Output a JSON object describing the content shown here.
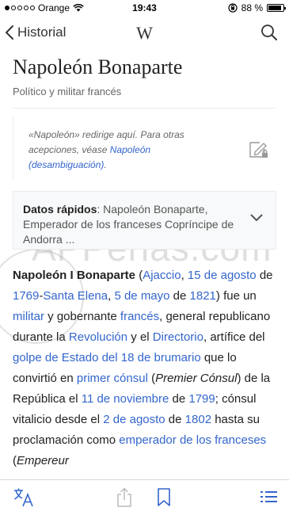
{
  "status": {
    "carrier": "Orange",
    "time": "19:43",
    "battery": "88 %",
    "battery_level": 0.88
  },
  "nav": {
    "back_label": "Historial",
    "logo": "W"
  },
  "article": {
    "title": "Napoleón Bonaparte",
    "subtitle": "Político y militar francés",
    "hatnote": {
      "pre": "«Napoleón» redirige aquí. Para otras acepciones, véase ",
      "link": "Napoleón (desambiguación)",
      "post": "."
    },
    "quick_facts": {
      "label": "Datos rápidos",
      "text": ": Napoleón Bonaparte, Emperador de los franceses Copríncipe de Andorra ..."
    },
    "paragraph": [
      {
        "t": "Napoleón I Bonaparte",
        "b": true
      },
      {
        "t": " ("
      },
      {
        "t": "Ajaccio",
        "l": true
      },
      {
        "t": ", "
      },
      {
        "t": "15 de agosto",
        "l": true
      },
      {
        "t": " de "
      },
      {
        "t": "1769",
        "l": true
      },
      {
        "t": "-"
      },
      {
        "t": "Santa Elena",
        "l": true
      },
      {
        "t": ", "
      },
      {
        "t": "5 de mayo",
        "l": true
      },
      {
        "t": " de "
      },
      {
        "t": "1821",
        "l": true
      },
      {
        "t": ") fue un "
      },
      {
        "t": "militar",
        "l": true
      },
      {
        "t": " y gobernante "
      },
      {
        "t": "francés",
        "l": true
      },
      {
        "t": ", general republicano durante la "
      },
      {
        "t": "Revolución",
        "l": true
      },
      {
        "t": " y el "
      },
      {
        "t": "Directorio",
        "l": true
      },
      {
        "t": ", artífice del "
      },
      {
        "t": "golpe de Estado del 18 de brumario",
        "l": true
      },
      {
        "t": " que lo convirtió en "
      },
      {
        "t": "primer cónsul",
        "l": true
      },
      {
        "t": " ("
      },
      {
        "t": "Premier Cónsul",
        "i": true
      },
      {
        "t": ") de la República el "
      },
      {
        "t": "11 de noviembre",
        "l": true
      },
      {
        "t": " de "
      },
      {
        "t": "1799",
        "l": true
      },
      {
        "t": "; cónsul vitalicio desde el "
      },
      {
        "t": "2 de agosto",
        "l": true
      },
      {
        "t": " de "
      },
      {
        "t": "1802",
        "l": true
      },
      {
        "t": " hasta su proclamación como "
      },
      {
        "t": "emperador de los franceses",
        "l": true
      },
      {
        "t": " ("
      },
      {
        "t": "Empereur",
        "i": true
      }
    ]
  },
  "watermark": "APPerlas.com",
  "toolbar": {
    "icons": [
      "translate-icon",
      "share-icon",
      "bookmark-icon",
      "table-of-contents-icon"
    ]
  },
  "colors": {
    "link": "#3366cc",
    "text": "#222222",
    "muted": "#666666"
  }
}
